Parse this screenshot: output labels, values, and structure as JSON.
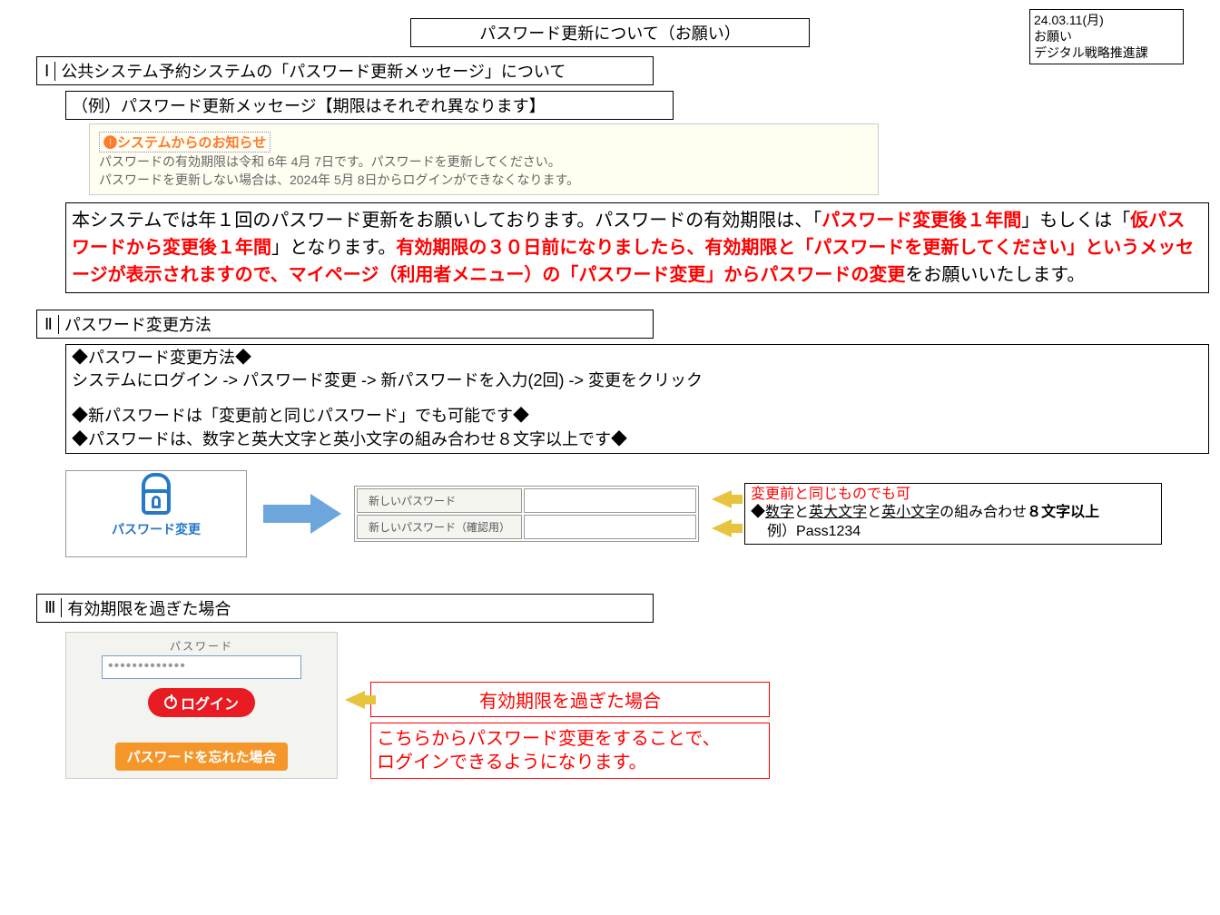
{
  "meta": {
    "date": "24.03.11(月)",
    "type": "お願い",
    "dept": "デジタル戦略推進課"
  },
  "title": "パスワード更新について（お願い）",
  "sect1": {
    "num": "Ⅰ",
    "head": "公共システム予約システムの「パスワード更新メッセージ」について",
    "sub": "（例）パスワード更新メッセージ【期限はそれぞれ異なります】",
    "notice": {
      "hdr": "❶システムからのお知らせ",
      "l1": "パスワードの有効期限は令和 6年 4月 7日です。パスワードを更新してください。",
      "l2": "パスワードを更新しない場合は、2024年 5月 8日からログインができなくなります。"
    },
    "body": {
      "p1a": "本システムでは年１回のパスワード更新をお願いしております。パスワードの有効期限は、「",
      "p1b": "パスワード変更後１年間",
      "p1c": "」もしくは「",
      "p1d": "仮パスワードから変更後１年間",
      "p1e": "」となります。",
      "p1f": "有効期限の３０日前になりましたら、有効期限と「パスワードを更新してください」というメッセージが表示されますので、マイページ（利用者メニュー）の「パスワード変更」からパスワードの変更",
      "p1g": "をお願いいたします。"
    }
  },
  "sect2": {
    "num": "Ⅱ",
    "head": "パスワード変更方法",
    "box": {
      "l1": "◆パスワード変更方法◆",
      "l2": "システムにログイン -> パスワード変更 -> 新パスワードを入力(2回) -> 変更をクリック",
      "l3": "◆新パスワードは「変更前と同じパスワード」でも可能です◆",
      "l4": "◆パスワードは、数字と英大文字と英小文字の組み合わせ８文字以上です◆"
    },
    "card": "パスワード変更",
    "grid": {
      "r1": "新しいパスワード",
      "r2": "新しいパスワード（確認用）"
    },
    "note": {
      "a1": "変更前と同じものでも可",
      "a2a": "◆",
      "a2b": "数字",
      "a2c": "と",
      "a2d": "英大文字",
      "a2e": "と",
      "a2f": "英小文字",
      "a2g": "の組み合わせ",
      "a2h": "８文字以上",
      "a3": "例）Pass1234"
    }
  },
  "sect3": {
    "num": "Ⅲ",
    "head": "有効期限を過ぎた場合",
    "login": {
      "lbl": "パスワード",
      "dots": "•••••••••••••",
      "btn": "ログイン",
      "forgot": "パスワードを忘れた場合"
    },
    "ttl": "有効期限を過ぎた場合",
    "txt1": "こちらからパスワード変更をすることで、",
    "txt2": "ログインできるようになります。"
  }
}
